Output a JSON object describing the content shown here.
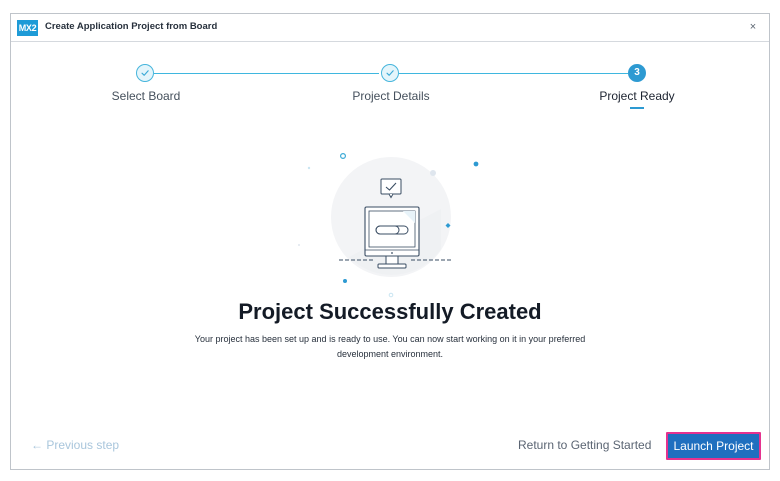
{
  "window": {
    "app_logo": "MX2",
    "title": "Create Application Project from Board",
    "close_glyph": "×"
  },
  "stepper": {
    "steps": [
      {
        "label": "Select Board",
        "state": "completed"
      },
      {
        "label": "Project Details",
        "state": "completed"
      },
      {
        "label": "Project Ready",
        "state": "current",
        "number": "3"
      }
    ]
  },
  "main": {
    "illustration_icon": "monitor-success-illustration",
    "headline": "Project Successfully Created",
    "description": "Your project has been set up and is ready to use. You can now start working on it in your preferred development environment."
  },
  "footer": {
    "previous_step_label": "← Previous step",
    "return_label": "Return to Getting Started",
    "launch_label": "Launch Project"
  },
  "colors": {
    "accent": "#2d9ad2",
    "primary_button": "#1f6fbf",
    "focus_ring": "#e5328f",
    "disabled_link": "#a9c6dc"
  }
}
